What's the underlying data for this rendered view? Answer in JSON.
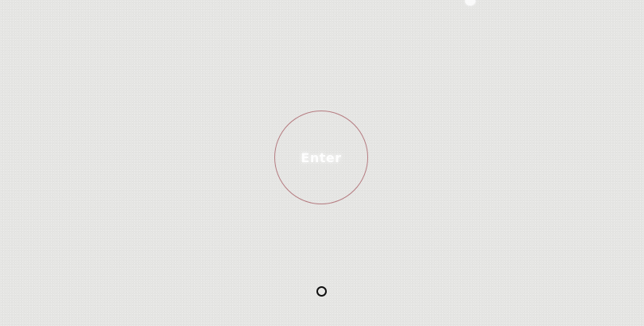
{
  "main": {
    "enter_button": {
      "label": "Enter",
      "border_color": "#b57b80",
      "label_color": "#ffffff"
    }
  },
  "colors": {
    "background": "#e5e5e3",
    "cursor": "#111111",
    "top_dot": "#fafafa"
  },
  "icons": {
    "cursor": "ring-cursor-icon",
    "top_dot": "light-dot-icon"
  }
}
